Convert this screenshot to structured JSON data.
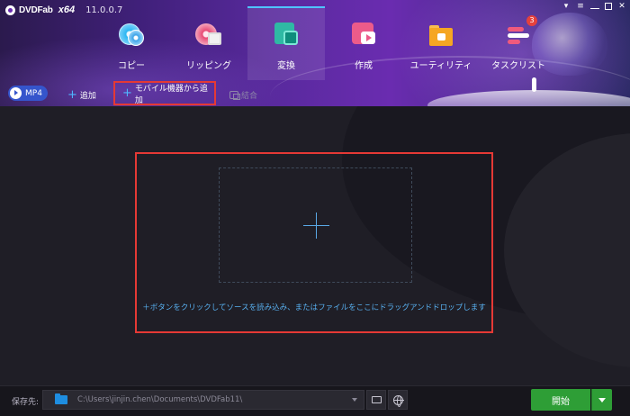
{
  "app": {
    "brand": "DVDFab",
    "arch": "x64",
    "version": "11.0.0.7"
  },
  "colors": {
    "accent": "#4fc4ff",
    "header_gradient_start": "#2b1a4d",
    "header_gradient_mid": "#6a2cb0",
    "highlight_red": "#e53935",
    "start_green": "#2e9e36",
    "badge_red": "#e5413c"
  },
  "nav": {
    "modules": [
      {
        "id": "copy",
        "label": "コピー",
        "icon": "disc-copy-icon",
        "active": false
      },
      {
        "id": "ripper",
        "label": "リッピング",
        "icon": "disc-ripper-icon",
        "active": false
      },
      {
        "id": "converter",
        "label": "変換",
        "icon": "video-convert-icon",
        "active": true
      },
      {
        "id": "creator",
        "label": "作成",
        "icon": "video-create-icon",
        "active": false
      },
      {
        "id": "utility",
        "label": "ユーティリティ",
        "icon": "toolbox-folder-icon",
        "active": false
      },
      {
        "id": "tasklist",
        "label": "タスクリスト",
        "icon": "task-list-icon",
        "active": false,
        "badge": "3"
      }
    ]
  },
  "toolbar": {
    "profile_label": "MP4",
    "add_label": "追加",
    "add_mobile_label": "モバイル機器から追加",
    "merge_label": "結合"
  },
  "main": {
    "dropzone_hint": "＋ボタンをクリックしてソースを読み込み、またはファイルをここにドラッグアンドドロップします"
  },
  "footer": {
    "save_to_label": "保存先:",
    "save_path": "C:\\Users\\jinjin.chen\\Documents\\DVDFab11\\",
    "start_label": "開始"
  }
}
